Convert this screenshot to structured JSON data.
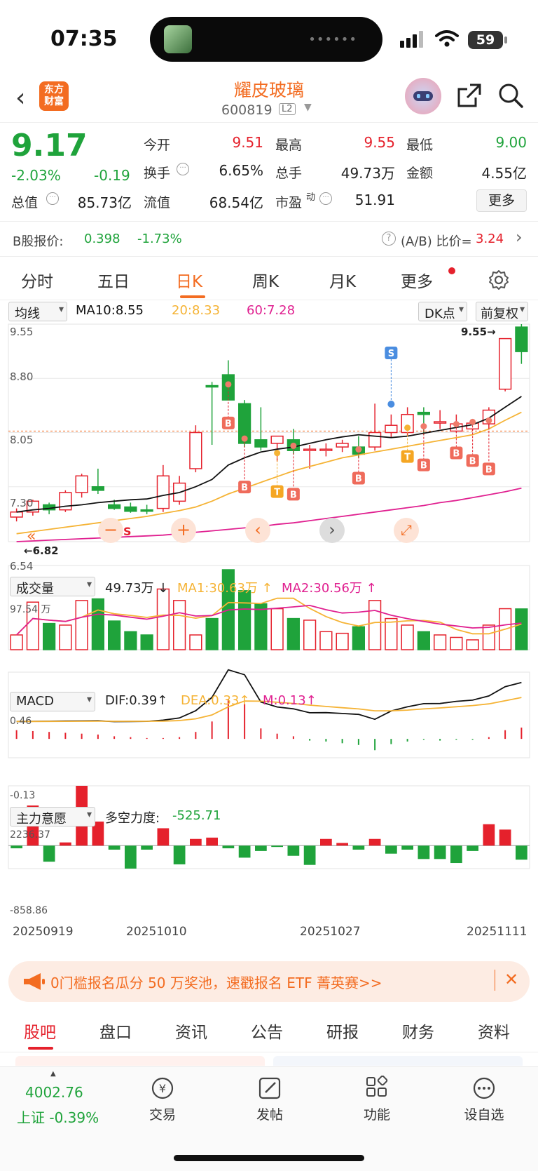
{
  "status_bar": {
    "time": "07:35",
    "battery": "59"
  },
  "header": {
    "stock_name": "耀皮玻璃",
    "stock_code": "600819",
    "level": "L2",
    "logo_text": "东方财富"
  },
  "quote": {
    "price": "9.17",
    "change_pct": "-2.03%",
    "change": "-0.19",
    "open_label": "今开",
    "open": "9.51",
    "high_label": "最高",
    "high": "9.55",
    "low_label": "最低",
    "low": "9.00",
    "turnover_label": "换手",
    "turnover": "6.65%",
    "volume_label": "总手",
    "volume": "49.73万",
    "amount_label": "金额",
    "amount": "4.55亿",
    "mktcap_label": "总值",
    "mktcap": "85.73亿",
    "float_label": "流值",
    "float": "68.54亿",
    "pe_label": "市盈",
    "pe_sup": "动",
    "pe": "51.91",
    "more_label": "更多"
  },
  "b_share": {
    "label": "B股报价:",
    "price": "0.398",
    "change": "-1.73%",
    "ratio_label": "(A/B) 比价=",
    "ratio": "3.24"
  },
  "tabs": [
    "分时",
    "五日",
    "日K",
    "周K",
    "月K",
    "更多"
  ],
  "active_tab": "日K",
  "kline": {
    "ma_selector": "均线",
    "ma10": "MA10:8.55",
    "ma20": "20:8.33",
    "ma60": "60:7.28",
    "dk_label": "DK点",
    "adjust_label": "前复权",
    "y_labels": [
      "9.55",
      "8.80",
      "8.05",
      "7.30",
      "6.54"
    ],
    "max_tag": "9.55",
    "min_tag": "6.82",
    "last_close_line": "8.05"
  },
  "volume": {
    "selector": "成交量",
    "value": "49.73万",
    "ma1": "MA1:30.63万",
    "ma2": "MA2:30.56万",
    "max_label": "97.54 万"
  },
  "macd": {
    "selector": "MACD",
    "dif": "DIF:0.39",
    "dea": "DEA:0.33",
    "m": "M:0.13",
    "max_label": "0.46",
    "min_label": "-0.13"
  },
  "force": {
    "selector": "主力意愿",
    "label": "多空力度:",
    "value": "-525.71",
    "max_label": "2236.37",
    "min_label": "-858.86"
  },
  "x_dates": [
    "20250919",
    "20251010",
    "20251027",
    "20251111"
  ],
  "chart_data": {
    "type": "candlestick",
    "ohlc": [
      [
        6.88,
        7.0,
        6.82,
        6.95
      ],
      [
        6.95,
        7.12,
        6.9,
        7.1
      ],
      [
        7.05,
        7.08,
        6.92,
        6.98
      ],
      [
        6.98,
        7.25,
        6.95,
        7.22
      ],
      [
        7.22,
        7.48,
        7.15,
        7.45
      ],
      [
        7.3,
        7.55,
        7.2,
        7.25
      ],
      [
        7.05,
        7.12,
        6.98,
        7.0
      ],
      [
        7.02,
        7.08,
        6.94,
        6.96
      ],
      [
        6.98,
        7.05,
        6.92,
        6.97
      ],
      [
        7.0,
        7.6,
        6.95,
        7.45
      ],
      [
        7.1,
        7.45,
        7.05,
        7.35
      ],
      [
        7.55,
        8.15,
        7.5,
        8.05
      ],
      [
        8.7,
        8.75,
        7.88,
        8.68
      ],
      [
        8.85,
        9.05,
        8.6,
        8.5
      ],
      [
        8.45,
        8.5,
        7.85,
        7.9
      ],
      [
        7.95,
        8.4,
        7.8,
        7.85
      ],
      [
        7.9,
        8.0,
        7.65,
        8.0
      ],
      [
        7.95,
        8.1,
        7.75,
        7.8
      ],
      [
        7.82,
        7.88,
        7.55,
        7.82
      ],
      [
        7.82,
        7.9,
        7.72,
        7.82
      ],
      [
        7.85,
        7.95,
        7.78,
        7.9
      ],
      [
        7.85,
        8.0,
        7.7,
        7.75
      ],
      [
        7.85,
        8.45,
        7.8,
        8.05
      ],
      [
        8.05,
        8.3,
        7.98,
        8.15
      ],
      [
        8.05,
        8.4,
        8.0,
        8.3
      ],
      [
        8.33,
        8.4,
        8.02,
        8.3
      ],
      [
        8.2,
        8.36,
        8.1,
        8.2
      ],
      [
        8.07,
        8.3,
        8.05,
        8.17
      ],
      [
        8.1,
        8.2,
        8.08,
        8.18
      ],
      [
        8.17,
        8.4,
        8.1,
        8.36
      ],
      [
        8.65,
        9.35,
        8.62,
        9.35
      ],
      [
        9.51,
        9.55,
        9.0,
        9.17
      ]
    ],
    "ma10": [
      6.95,
      6.98,
      7.0,
      7.03,
      7.05,
      7.08,
      7.1,
      7.12,
      7.13,
      7.18,
      7.22,
      7.3,
      7.4,
      7.6,
      7.7,
      7.78,
      7.82,
      7.85,
      7.9,
      7.95,
      7.99,
      8.02,
      8.0,
      7.98,
      8.0,
      8.04,
      8.08,
      8.12,
      8.16,
      8.25,
      8.4,
      8.55
    ],
    "ma20": [
      6.65,
      6.68,
      6.71,
      6.74,
      6.77,
      6.8,
      6.83,
      6.86,
      6.89,
      6.93,
      6.97,
      7.02,
      7.1,
      7.2,
      7.28,
      7.36,
      7.44,
      7.52,
      7.58,
      7.64,
      7.7,
      7.74,
      7.78,
      7.82,
      7.86,
      7.9,
      7.94,
      7.98,
      8.02,
      8.1,
      8.22,
      8.33
    ],
    "ma60": [
      6.54,
      6.55,
      6.56,
      6.57,
      6.58,
      6.59,
      6.6,
      6.61,
      6.62,
      6.63,
      6.65,
      6.67,
      6.69,
      6.71,
      6.73,
      6.75,
      6.78,
      6.8,
      6.83,
      6.86,
      6.89,
      6.92,
      6.95,
      6.98,
      7.01,
      7.04,
      7.08,
      7.11,
      7.15,
      7.19,
      7.23,
      7.28
    ],
    "volume": [
      18,
      58,
      32,
      30,
      60,
      62,
      35,
      22,
      18,
      74,
      60,
      18,
      38,
      97.54,
      72,
      56,
      50,
      38,
      36,
      22,
      20,
      28,
      60,
      38,
      30,
      22,
      18,
      15,
      12,
      30,
      50,
      49.73
    ],
    "macd_hist": [
      0.1,
      0.09,
      0.08,
      0.07,
      0.06,
      0.05,
      0.03,
      0.02,
      0.01,
      0.01,
      0.02,
      0.08,
      0.2,
      0.46,
      0.4,
      0.12,
      0.06,
      0.03,
      -0.02,
      -0.03,
      -0.05,
      -0.07,
      -0.13,
      -0.06,
      -0.03,
      -0.01,
      -0.02,
      -0.01,
      -0.01,
      0.02,
      0.1,
      0.13
    ],
    "force": [
      -100,
      1500,
      -600,
      120,
      2236.37,
      900,
      -150,
      -858.86,
      -150,
      650,
      -700,
      250,
      300,
      -100,
      -450,
      -200,
      -50,
      -380,
      -720,
      250,
      100,
      -150,
      250,
      -300,
      -150,
      -500,
      -500,
      -650,
      -200,
      800,
      600,
      -525.71
    ]
  },
  "banner": {
    "text": "0门槛报名瓜分 50 万奖池，速戳报名 ETF 菁英赛>>"
  },
  "bottom_tabs": [
    "股吧",
    "盘口",
    "资讯",
    "公告",
    "研报",
    "财务",
    "资料"
  ],
  "footer": {
    "index_value": "4002.76",
    "index_label": "上证 -0.39%",
    "trade": "交易",
    "post": "发帖",
    "func": "功能",
    "watch": "设自选"
  },
  "colors": {
    "up": "#e5212c",
    "down": "#1fa33b",
    "accent": "#f36c21",
    "ma10": "#111111",
    "ma20": "#f5b335",
    "ma60": "#e02090"
  }
}
